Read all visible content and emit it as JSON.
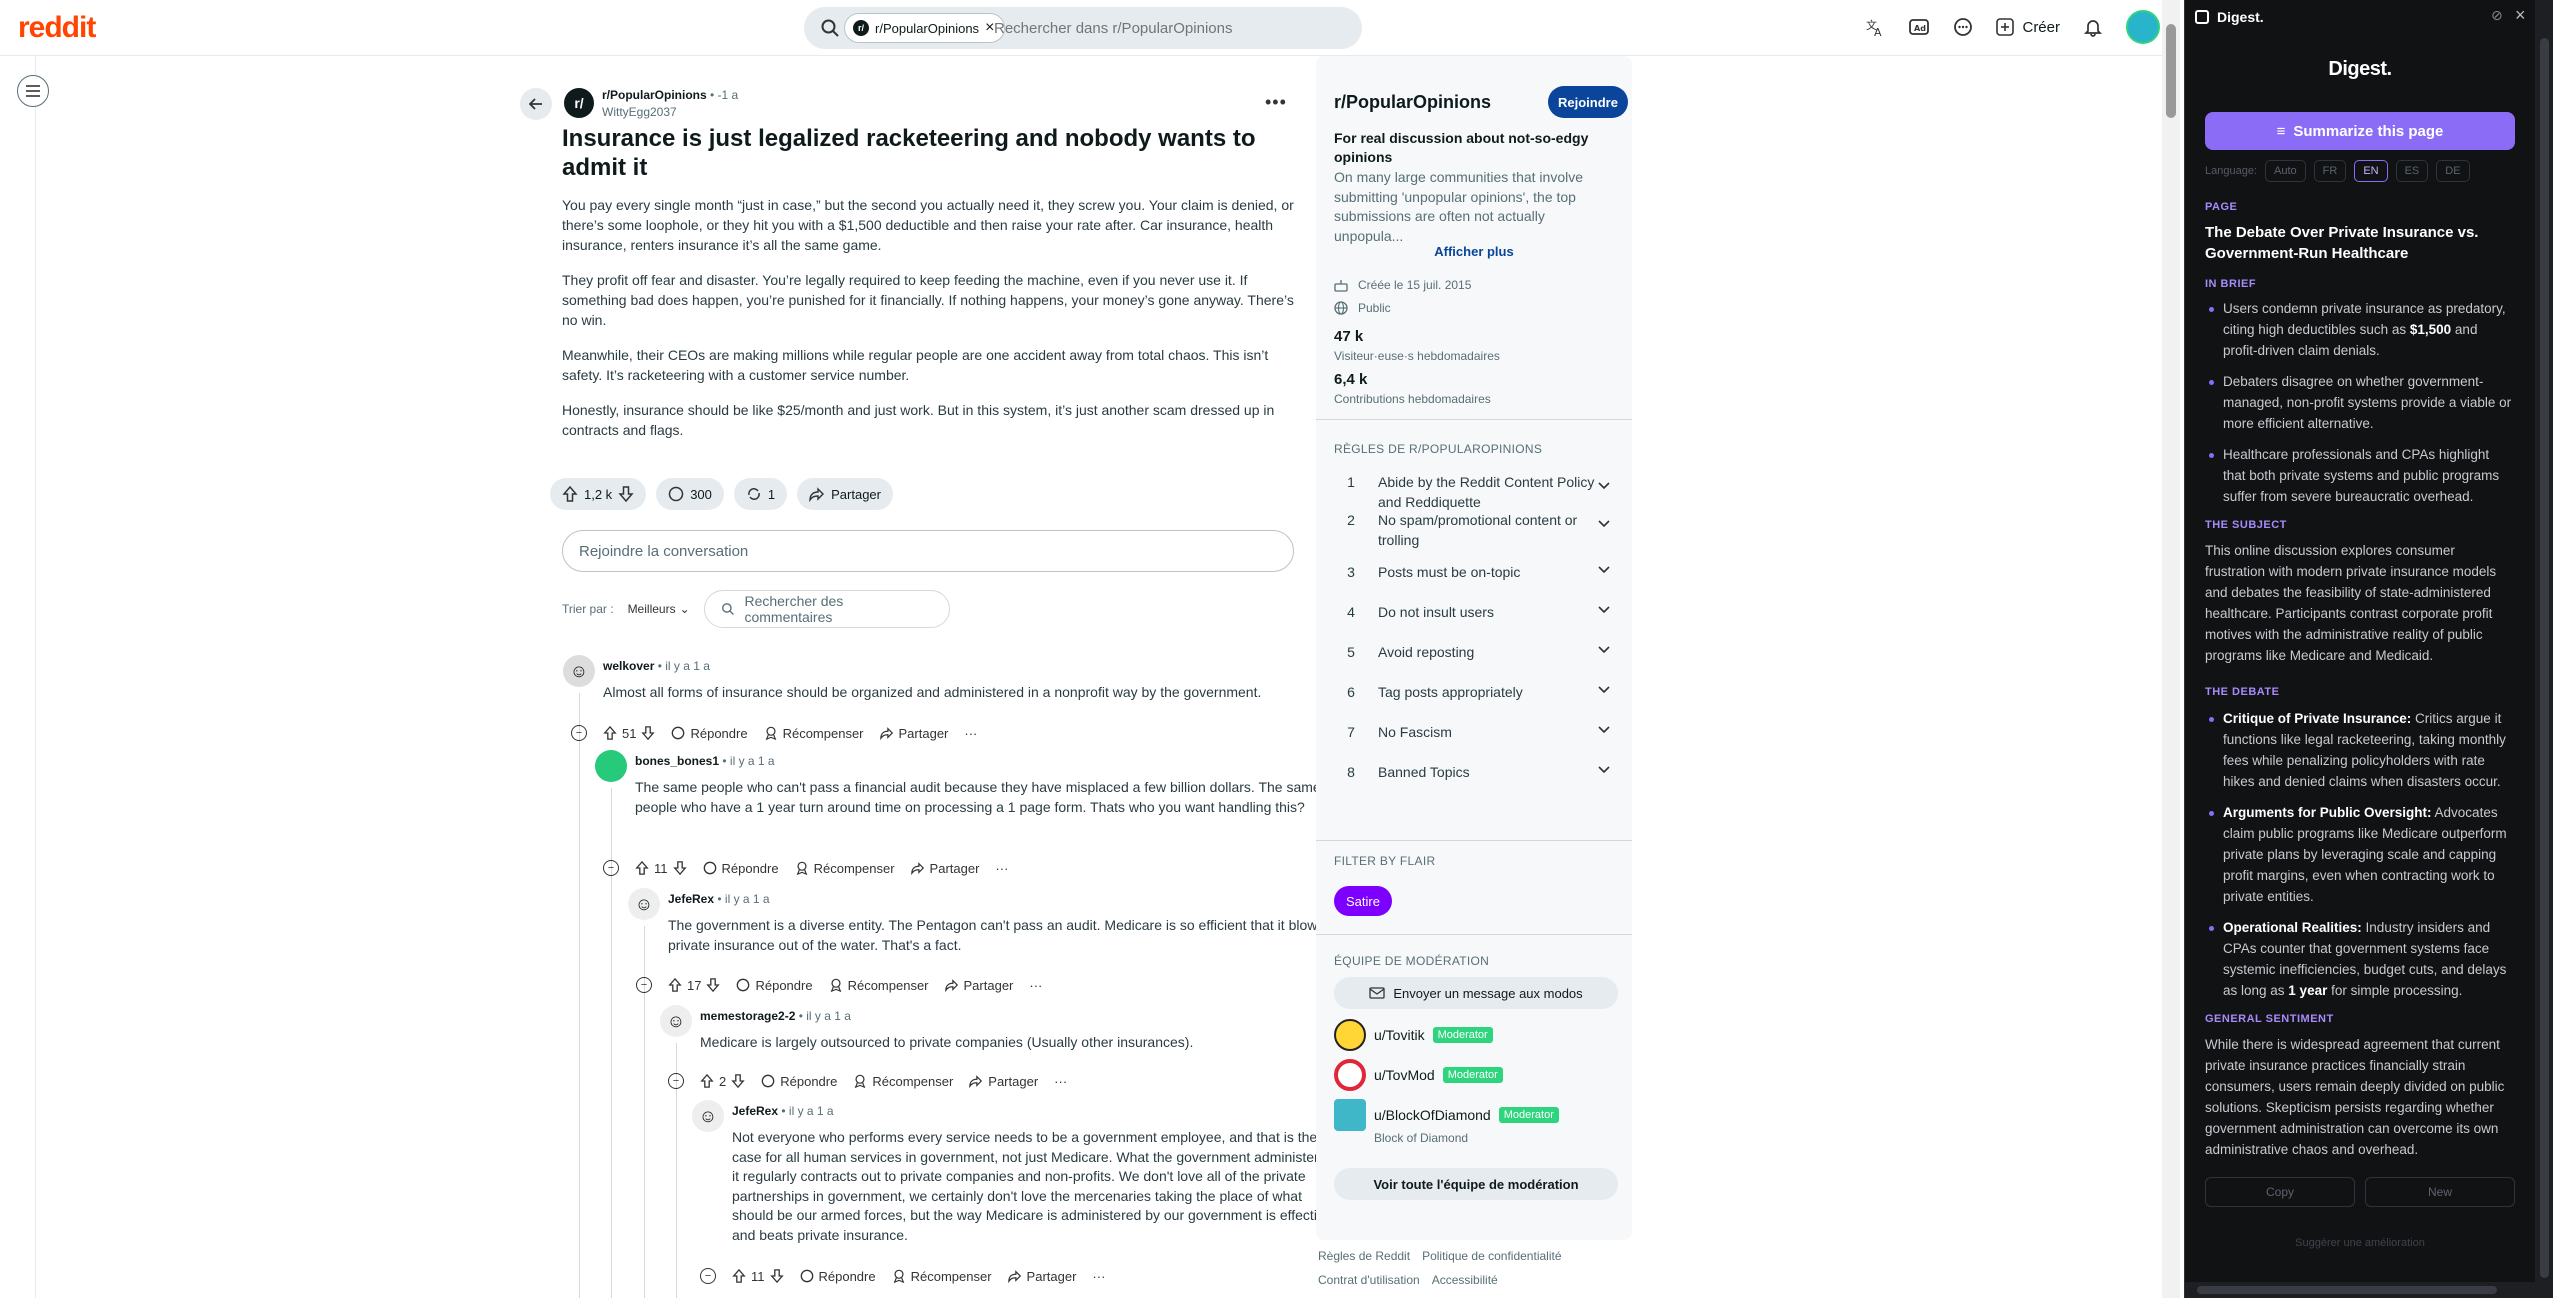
{
  "topbar": {
    "logo": "reddit",
    "search_chip": "r/PopularOpinions",
    "search_chip_avatar": "r/",
    "search_placeholder": "Rechercher dans r/PopularOpinions",
    "create_label": "Créer"
  },
  "post": {
    "subreddit": "r/PopularOpinions",
    "subreddit_avatar": "r/",
    "time": " • -1 a",
    "author": "WittyEgg2037",
    "title": "Insurance is just legalized racketeering and nobody wants to admit it",
    "paragraphs": [
      "You pay every single month “just in case,” but the second you actually need it, they screw you. Your claim is denied, or there’s some loophole, or they hit you with a $1,500 deductible and then raise your rate after. Car insurance, health insurance, renters insurance it’s all the same game.",
      "They profit off fear and disaster. You’re legally required to keep feeding the machine, even if you never use it. If something bad does happen, you’re punished for it financially. If nothing happens, your money’s gone anyway. There’s no win.",
      "Meanwhile, their CEOs are making millions while regular people are one accident away from total chaos. This isn’t safety. It’s racketeering with a customer service number.",
      "Honestly, insurance should be like $25/month and just work. But in this system, it’s just another scam dressed up in contracts and flags."
    ],
    "votes": "1,2 k",
    "comments": "300",
    "crossposts": "1",
    "share": "Partager",
    "join_conversation": "Rejoindre la conversation",
    "sort_label": "Trier par :",
    "sort_value": "Meilleurs",
    "search_comments": "Rechercher des commentaires"
  },
  "comments": [
    {
      "author": "welkover",
      "time": " • il y a 1 a",
      "text": "Almost all forms of insurance should be organized and administered in a nonprofit way by the government.",
      "votes": "51"
    },
    {
      "author": "bones_bones1",
      "time": " • il y a 1 a",
      "text": "The same people who can't pass a financial audit because they have misplaced a few billion dollars. The same people who have a 1 year turn around time on processing a 1 page form. Thats who you want handling this?",
      "votes": "11"
    },
    {
      "author": "JefeRex",
      "time": " • il y a 1 a",
      "text": "The government is a diverse entity. The Pentagon can't pass an audit. Medicare is so efficient that it blows private insurance out of the water. That's a fact.",
      "votes": "17"
    },
    {
      "author": "memestorage2-2",
      "time": " • il y a 1 a",
      "text": "Medicare is largely outsourced to private companies (Usually other insurances).",
      "votes": "2"
    },
    {
      "author": "JefeRex",
      "time": " • il y a 1 a",
      "text": "Not everyone who performs every service needs to be a government employee, and that is the case for all human services in government, not just Medicare. What the government administers it regularly contracts out to private companies and non-profits. We don't love all of the private partnerships in government, we certainly don't love the mercenaries taking the place of what should be our armed forces, but the way Medicare is administered by our government is effective and beats private insurance.",
      "votes": "11"
    }
  ],
  "comment_actions": {
    "reply": "Répondre",
    "award": "Récompenser",
    "share": "Partager",
    "more": "···"
  },
  "sidebar": {
    "name": "r/PopularOpinions",
    "join": "Rejoindre",
    "subtitle": "For real discussion about not-so-edgy opinions",
    "description": "On many large communities that involve submitting 'unpopular opinions', the top submissions are often not actually unpopula...",
    "show_more": "Afficher plus",
    "created": "Créée le 15 juil. 2015",
    "visibility": "Public",
    "visitors": "47 k",
    "visitors_label": "Visiteur·euse·s hebdomadaires",
    "contributions": "6,4 k",
    "contributions_label": "Contributions hebdomadaires",
    "rules_heading": "RÈGLES DE R/POPULAROPINIONS",
    "rules": [
      {
        "n": "1",
        "text": "Abide by the Reddit Content Policy and Reddiquette"
      },
      {
        "n": "2",
        "text": "No spam/promotional content or trolling"
      },
      {
        "n": "3",
        "text": "Posts must be on-topic"
      },
      {
        "n": "4",
        "text": "Do not insult users"
      },
      {
        "n": "5",
        "text": "Avoid reposting"
      },
      {
        "n": "6",
        "text": "Tag posts appropriately"
      },
      {
        "n": "7",
        "text": "No Fascism"
      },
      {
        "n": "8",
        "text": "Banned Topics"
      }
    ],
    "flair_heading": "FILTER BY FLAIR",
    "flair": "Satire",
    "mod_heading": "ÉQUIPE DE MODÉRATION",
    "message_mods": "Envoyer un message aux modos",
    "mods": [
      {
        "name": "u/Tovitik",
        "badge": "Moderator"
      },
      {
        "name": "u/TovMod",
        "badge": "Moderator"
      },
      {
        "name": "u/BlockOfDiamond",
        "badge": "Moderator"
      }
    ],
    "mod_flair": "Block of Diamond",
    "view_all_mods": "Voir toute l'équipe de modération",
    "footer1": [
      "Règles de Reddit",
      "Politique de confidentialité"
    ],
    "footer2": [
      "Contrat d'utilisation",
      "Accessibilité"
    ]
  },
  "digest": {
    "ext_name": "Digest.",
    "logo": "Digest.",
    "summarize": "Summarize this page",
    "language_label": "Language:",
    "languages": [
      "Auto",
      "FR",
      "EN",
      "ES",
      "DE"
    ],
    "page_heading": "PAGE",
    "page_title": "The Debate Over Private Insurance vs. Government-Run Healthcare",
    "brief_heading": "IN BRIEF",
    "brief": [
      {
        "pre": "Users condemn private insurance as predatory, citing high deductibles such as ",
        "bold": "$1,500",
        "post": " and profit-driven claim denials."
      },
      {
        "pre": "Debaters disagree on whether government-managed, non-profit systems provide a viable or more efficient alternative.",
        "bold": "",
        "post": ""
      },
      {
        "pre": "Healthcare professionals and CPAs highlight that both private systems and public programs suffer from severe bureaucratic overhead.",
        "bold": "",
        "post": ""
      }
    ],
    "subject_heading": "THE SUBJECT",
    "subject": "This online discussion explores consumer frustration with modern private insurance models and debates the feasibility of state-administered healthcare. Participants contrast corporate profit motives with the administrative reality of public programs like Medicare and Medicaid.",
    "debate_heading": "THE DEBATE",
    "debate": [
      {
        "bold": "Critique of Private Insurance:",
        "text": " Critics argue it functions like legal racketeering, taking monthly fees while penalizing policyholders with rate hikes and denied claims when disasters occur."
      },
      {
        "bold": "Arguments for Public Oversight:",
        "text": " Advocates claim public programs like Medicare outperform private plans by leveraging scale and capping profit margins, even when contracting work to private entities."
      },
      {
        "bold": "Operational Realities:",
        "text": " Industry insiders and CPAs counter that government systems face systemic inefficiencies, budget cuts, and delays as long as ",
        "bold2": "1 year",
        "post": " for simple processing."
      }
    ],
    "sentiment_heading": "GENERAL SENTIMENT",
    "sentiment": "While there is widespread agreement that current private insurance practices financially strain consumers, users remain deeply divided on public solutions. Skepticism persists regarding whether government administration can overcome its own administrative chaos and overhead.",
    "copy": "Copy",
    "new": "New",
    "suggest": "Suggérer une amélioration"
  }
}
